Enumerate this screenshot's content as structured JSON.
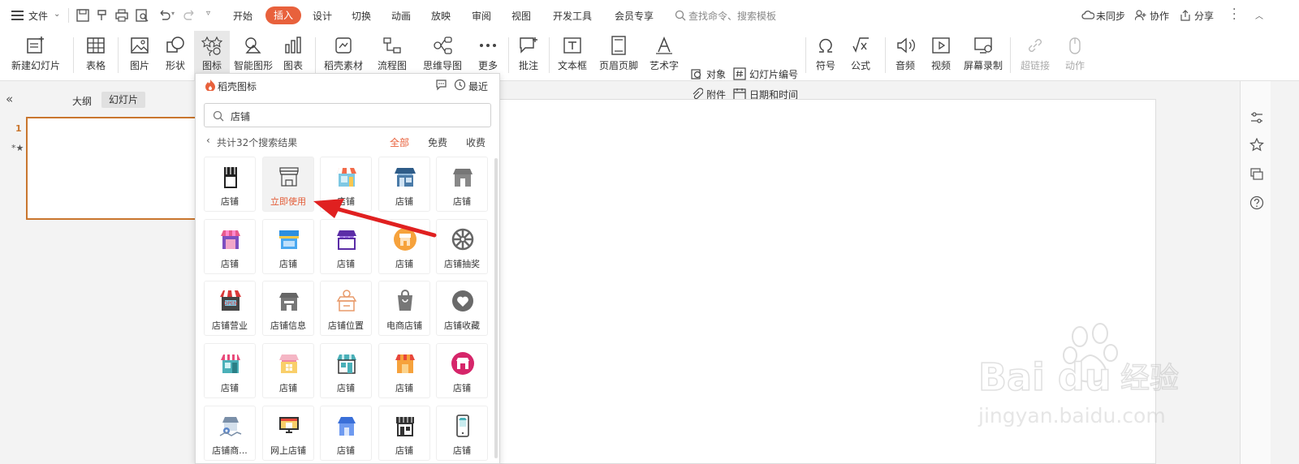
{
  "menubar": {
    "file": "文件",
    "tabs": [
      "开始",
      "插入",
      "设计",
      "切换",
      "动画",
      "放映",
      "审阅",
      "视图",
      "开发工具",
      "会员专享"
    ],
    "search_placeholder": "查找命令、搜索模板",
    "unsynced": "未同步",
    "collab": "协作",
    "share": "分享"
  },
  "ribbon": {
    "new_slide": "新建幻灯片",
    "table": "表格",
    "picture": "图片",
    "shape": "形状",
    "icon": "图标",
    "smartart": "智能图形",
    "chart": "图表",
    "docer": "稻壳素材",
    "flowchart": "流程图",
    "mindmap": "思维导图",
    "more": "更多",
    "comment": "批注",
    "textbox": "文本框",
    "header_footer": "页眉页脚",
    "wordart": "艺术字",
    "object": "对象",
    "attachment": "附件",
    "slide_number": "幻灯片编号",
    "datetime": "日期和时间",
    "symbol": "符号",
    "formula": "公式",
    "audio": "音频",
    "video": "视频",
    "screen_record": "屏幕录制",
    "hyperlink": "超链接",
    "action": "动作"
  },
  "left_panel": {
    "outline": "大纲",
    "slides": "幻灯片",
    "slide_num": "1"
  },
  "popup": {
    "title": "稻壳图标",
    "recent": "最近",
    "search_value": "店铺",
    "count": "共计32个搜索结果",
    "filters": [
      "全部",
      "免费",
      "收费"
    ],
    "hover_label": "立即使用",
    "items": [
      "店铺",
      "店铺",
      "店铺",
      "店铺",
      "店铺",
      "店铺",
      "店铺",
      "店铺",
      "店铺",
      "店铺抽奖",
      "店铺营业",
      "店铺信息",
      "店铺位置",
      "电商店铺",
      "店铺收藏",
      "店铺",
      "店铺",
      "店铺",
      "店铺",
      "店铺",
      "店铺商...",
      "网上店铺",
      "店铺",
      "店铺",
      "店铺"
    ]
  },
  "watermark": {
    "brand": "Bai du 经验",
    "url": "jingyan.baidu.com"
  },
  "colors": {
    "accent": "#e8613c",
    "arrow": "#e02020",
    "thumb_border": "#c9762e"
  }
}
